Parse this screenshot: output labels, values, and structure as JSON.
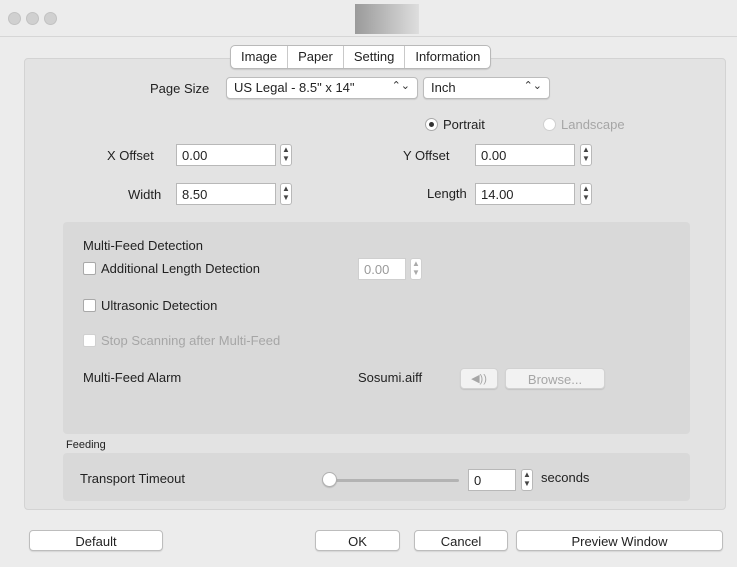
{
  "tabs": [
    "Image",
    "Paper",
    "Setting",
    "Information"
  ],
  "paper": {
    "page_size_label": "Page Size",
    "page_size_value": "US Legal - 8.5\" x 14\"",
    "unit_value": "Inch",
    "orientation": {
      "portrait": "Portrait",
      "landscape": "Landscape",
      "selected": "Portrait"
    },
    "x_offset_label": "X Offset",
    "x_offset_value": "0.00",
    "y_offset_label": "Y Offset",
    "y_offset_value": "0.00",
    "width_label": "Width",
    "width_value": "8.50",
    "length_label": "Length",
    "length_value": "14.00"
  },
  "multifeed": {
    "title": "Multi-Feed Detection",
    "additional_length": "Additional Length Detection",
    "additional_length_value": "0.00",
    "ultrasonic": "Ultrasonic Detection",
    "stop_scanning": "Stop Scanning after Multi-Feed",
    "alarm_label": "Multi-Feed Alarm",
    "alarm_file": "Sosumi.aiff",
    "speaker_icon": "speaker-icon",
    "browse": "Browse..."
  },
  "feeding": {
    "title": "Feeding",
    "transport_timeout_label": "Transport Timeout",
    "timeout_value": "0",
    "timeout_unit": "seconds",
    "slider_level": 0
  },
  "buttons": {
    "default": "Default",
    "ok": "OK",
    "cancel": "Cancel",
    "preview": "Preview Window"
  },
  "colors": {
    "window_bg": "#ececec",
    "panel_bg": "#e3e3e3",
    "group_bg": "#d9d9d9"
  }
}
